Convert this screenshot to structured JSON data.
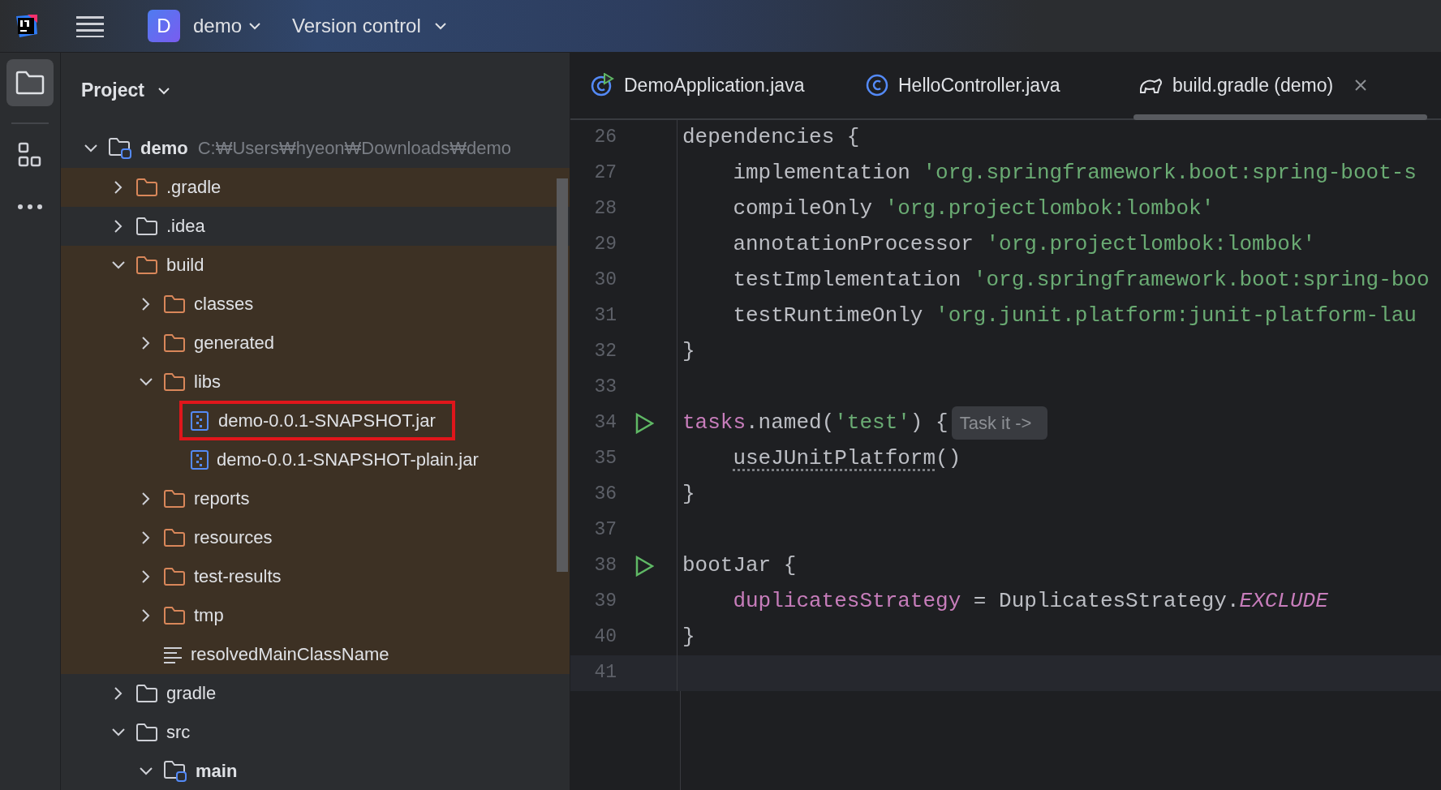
{
  "top_bar": {
    "project_widget": {
      "badge": "D",
      "label": "demo"
    },
    "vcs_widget": {
      "label": "Version control"
    }
  },
  "tool_window": {
    "title": "Project"
  },
  "tree": [
    {
      "name": "demo",
      "kind": "module",
      "path": "C:₩Users₩hyeon₩Downloads₩demo",
      "expanded": true,
      "children": [
        {
          "name": ".gradle",
          "kind": "folder",
          "expanded": false,
          "excluded": true
        },
        {
          "name": ".idea",
          "kind": "folder",
          "expanded": false,
          "excluded": false
        },
        {
          "name": "build",
          "kind": "folder",
          "expanded": true,
          "excluded": true,
          "children": [
            {
              "name": "classes",
              "kind": "folder",
              "expanded": false
            },
            {
              "name": "generated",
              "kind": "folder",
              "expanded": false
            },
            {
              "name": "libs",
              "kind": "folder",
              "expanded": true,
              "children": [
                {
                  "name": "demo-0.0.1-SNAPSHOT.jar",
                  "kind": "jar",
                  "outlined": true
                },
                {
                  "name": "demo-0.0.1-SNAPSHOT-plain.jar",
                  "kind": "jar",
                  "outlined": false
                }
              ]
            },
            {
              "name": "reports",
              "kind": "folder",
              "expanded": false
            },
            {
              "name": "resources",
              "kind": "folder",
              "expanded": false
            },
            {
              "name": "test-results",
              "kind": "folder",
              "expanded": false
            },
            {
              "name": "tmp",
              "kind": "folder",
              "expanded": false
            },
            {
              "name": "resolvedMainClassName",
              "kind": "text"
            }
          ]
        },
        {
          "name": "gradle",
          "kind": "folder",
          "expanded": false,
          "excluded": false
        },
        {
          "name": "src",
          "kind": "folder",
          "expanded": true,
          "excluded": false,
          "children": [
            {
              "name": "main",
              "kind": "module",
              "expanded": true
            }
          ]
        }
      ]
    }
  ],
  "tabs": [
    {
      "label": "DemoApplication.java",
      "kind": "java-main",
      "selected": false
    },
    {
      "label": "HelloController.java",
      "kind": "java-class",
      "selected": false
    },
    {
      "label": "build.gradle (demo)",
      "kind": "gradle",
      "selected": true
    }
  ],
  "code_lines": [
    {
      "number": "26",
      "tokens": [
        {
          "text": "dependencies {",
          "kind": "plain"
        }
      ]
    },
    {
      "number": "27",
      "tokens": [
        {
          "text": "    implementation ",
          "kind": "plain"
        },
        {
          "text": "'org.springframework.boot:spring-boot-s",
          "kind": "string"
        }
      ]
    },
    {
      "number": "28",
      "tokens": [
        {
          "text": "    compileOnly ",
          "kind": "plain"
        },
        {
          "text": "'org.projectlombok:lombok'",
          "kind": "string"
        }
      ]
    },
    {
      "number": "29",
      "tokens": [
        {
          "text": "    annotationProcessor ",
          "kind": "plain"
        },
        {
          "text": "'org.projectlombok:lombok'",
          "kind": "string"
        }
      ]
    },
    {
      "number": "30",
      "tokens": [
        {
          "text": "    testImplementation ",
          "kind": "plain"
        },
        {
          "text": "'org.springframework.boot:spring-boo",
          "kind": "string"
        }
      ]
    },
    {
      "number": "31",
      "tokens": [
        {
          "text": "    testRuntimeOnly ",
          "kind": "plain"
        },
        {
          "text": "'org.junit.platform:junit-platform-lau",
          "kind": "string"
        }
      ]
    },
    {
      "number": "32",
      "tokens": [
        {
          "text": "}",
          "kind": "plain"
        }
      ]
    },
    {
      "number": "33"
    },
    {
      "number": "34",
      "run": true,
      "tokens": [
        {
          "text": "tasks",
          "kind": "keyword"
        },
        {
          "text": ".named(",
          "kind": "plain"
        },
        {
          "text": "'test'",
          "kind": "string"
        },
        {
          "text": ") {",
          "kind": "plain"
        },
        {
          "text": "Task it ->",
          "kind": "hint"
        }
      ]
    },
    {
      "number": "35",
      "indented": true,
      "tokens": [
        {
          "text": "useJUnitPlatform",
          "kind": "call"
        },
        {
          "text": "()",
          "kind": "plain"
        }
      ]
    },
    {
      "number": "36",
      "tokens": [
        {
          "text": "}",
          "kind": "plain"
        }
      ]
    },
    {
      "number": "37"
    },
    {
      "number": "38",
      "run": true,
      "tokens": [
        {
          "text": "bootJar {",
          "kind": "plain"
        }
      ]
    },
    {
      "number": "39",
      "indented": true,
      "tokens": [
        {
          "text": "duplicatesStrategy",
          "kind": "keyword"
        },
        {
          "text": " = DuplicatesStrategy.",
          "kind": "plain"
        },
        {
          "text": "EXCLUDE",
          "kind": "constant"
        }
      ]
    },
    {
      "number": "40",
      "tokens": [
        {
          "text": "}",
          "kind": "plain"
        }
      ]
    },
    {
      "number": "41",
      "current": true
    }
  ]
}
